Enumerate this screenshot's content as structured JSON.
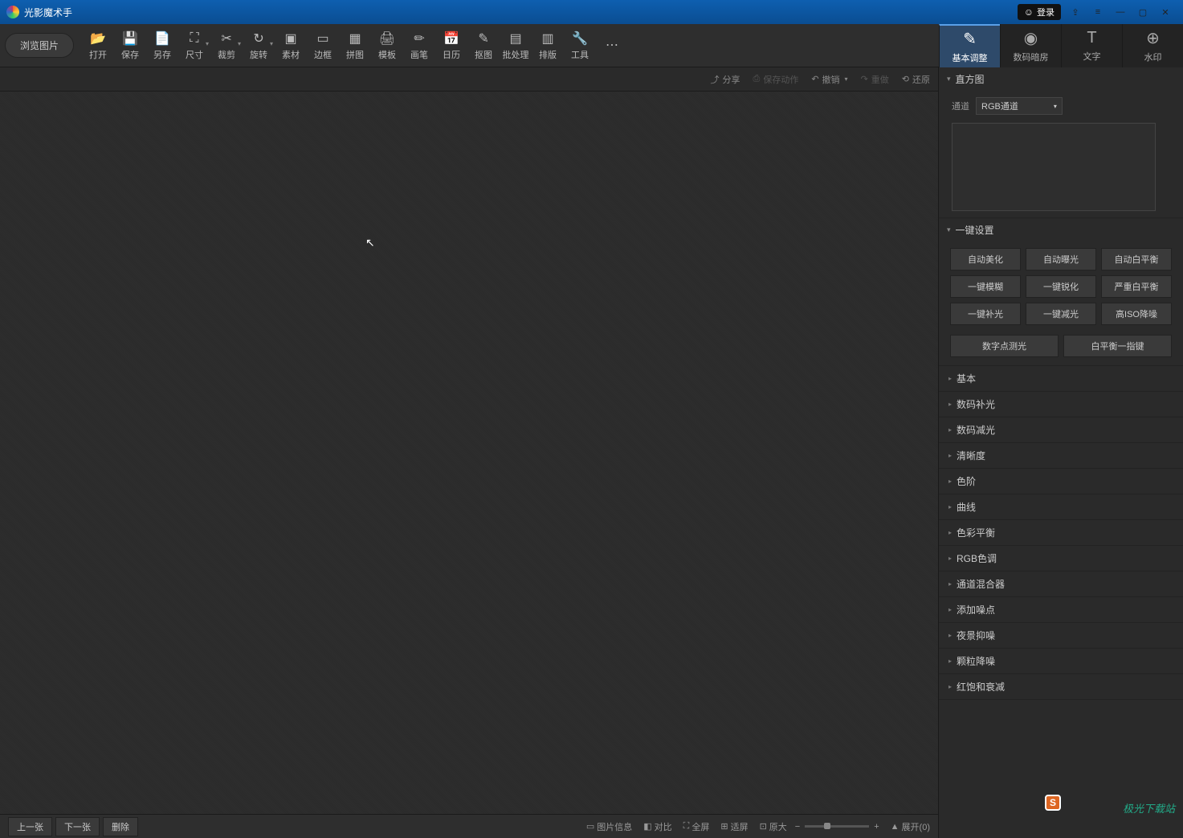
{
  "titlebar": {
    "app_name": "光影魔术手",
    "login": "登录"
  },
  "toolbar": {
    "browse": "浏览图片",
    "items": [
      {
        "label": "打开",
        "icon": "📂"
      },
      {
        "label": "保存",
        "icon": "💾"
      },
      {
        "label": "另存",
        "icon": "📄"
      },
      {
        "label": "尺寸",
        "icon": "⛶",
        "dd": true
      },
      {
        "label": "裁剪",
        "icon": "✂",
        "dd": true
      },
      {
        "label": "旋转",
        "icon": "↻",
        "dd": true
      },
      {
        "label": "素材",
        "icon": "▣"
      },
      {
        "label": "边框",
        "icon": "▭"
      },
      {
        "label": "拼图",
        "icon": "▦"
      },
      {
        "label": "模板",
        "icon": "🖨"
      },
      {
        "label": "画笔",
        "icon": "✏"
      },
      {
        "label": "日历",
        "icon": "📅"
      },
      {
        "label": "抠图",
        "icon": "✎"
      },
      {
        "label": "批处理",
        "icon": "▤"
      },
      {
        "label": "排版",
        "icon": "▥"
      },
      {
        "label": "工具",
        "icon": "🔧"
      },
      {
        "label": "",
        "icon": "⋯"
      }
    ]
  },
  "right_tabs": [
    {
      "label": "基本调整",
      "icon": "✎"
    },
    {
      "label": "数码暗房",
      "icon": "◉"
    },
    {
      "label": "文字",
      "icon": "T"
    },
    {
      "label": "水印",
      "icon": "⊕"
    }
  ],
  "actionbar": {
    "share": "分享",
    "save_action": "保存动作",
    "undo": "撤销",
    "redo": "重做",
    "restore": "还原"
  },
  "panel": {
    "histogram": {
      "title": "直方图",
      "channel_label": "通道",
      "channel_value": "RGB通道"
    },
    "oneclick": {
      "title": "一键设置",
      "buttons": [
        "自动美化",
        "自动曝光",
        "自动白平衡",
        "一键模糊",
        "一键锐化",
        "严重白平衡",
        "一键补光",
        "一键减光",
        "高ISO降噪"
      ],
      "row2": [
        "数字点测光",
        "白平衡一指键"
      ]
    },
    "accordion": [
      "基本",
      "数码补光",
      "数码减光",
      "清晰度",
      "色阶",
      "曲线",
      "色彩平衡",
      "RGB色调",
      "通道混合器",
      "添加噪点",
      "夜景抑噪",
      "颗粒降噪",
      "红饱和衰减"
    ]
  },
  "bottombar": {
    "prev": "上一张",
    "next": "下一张",
    "delete": "删除",
    "image_info": "图片信息",
    "compare": "对比",
    "fullscreen": "全屏",
    "fitscreen": "适屏",
    "original": "原大",
    "expand": "展开(0)"
  },
  "watermark": "极光下载站"
}
